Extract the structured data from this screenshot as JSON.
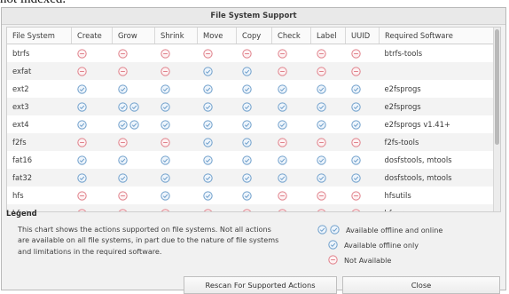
{
  "page_fragment": "not indexed.",
  "dialog": {
    "title": "File System Support"
  },
  "table": {
    "columns": [
      "File System",
      "Create",
      "Grow",
      "Shrink",
      "Move",
      "Copy",
      "Check",
      "Label",
      "UUID",
      "Required Software"
    ],
    "rows": [
      {
        "fs": "btrfs",
        "cells": [
          "na",
          "na",
          "na",
          "na",
          "na",
          "na",
          "na",
          "na"
        ],
        "software": "btrfs-tools"
      },
      {
        "fs": "exfat",
        "cells": [
          "na",
          "na",
          "na",
          "offline",
          "offline",
          "na",
          "na",
          "na"
        ],
        "software": ""
      },
      {
        "fs": "ext2",
        "cells": [
          "offline",
          "offline",
          "offline",
          "offline",
          "offline",
          "offline",
          "offline",
          "offline"
        ],
        "software": "e2fsprogs"
      },
      {
        "fs": "ext3",
        "cells": [
          "offline",
          "both",
          "offline",
          "offline",
          "offline",
          "offline",
          "offline",
          "offline"
        ],
        "software": "e2fsprogs"
      },
      {
        "fs": "ext4",
        "cells": [
          "offline",
          "both",
          "offline",
          "offline",
          "offline",
          "offline",
          "offline",
          "offline"
        ],
        "software": "e2fsprogs v1.41+"
      },
      {
        "fs": "f2fs",
        "cells": [
          "na",
          "na",
          "na",
          "offline",
          "offline",
          "na",
          "na",
          "na"
        ],
        "software": "f2fs-tools"
      },
      {
        "fs": "fat16",
        "cells": [
          "offline",
          "offline",
          "offline",
          "offline",
          "offline",
          "offline",
          "offline",
          "offline"
        ],
        "software": "dosfstools, mtools"
      },
      {
        "fs": "fat32",
        "cells": [
          "offline",
          "offline",
          "offline",
          "offline",
          "offline",
          "offline",
          "offline",
          "offline"
        ],
        "software": "dosfstools, mtools"
      },
      {
        "fs": "hfs",
        "cells": [
          "na",
          "na",
          "offline",
          "offline",
          "offline",
          "na",
          "na",
          "na"
        ],
        "software": "hfsutils"
      },
      {
        "fs": "hfs+",
        "cells": [
          "na",
          "na",
          "na",
          "na",
          "na",
          "na",
          "na",
          "na"
        ],
        "software": "hfsprogs"
      }
    ]
  },
  "legend": {
    "title": "Legend",
    "text": "This chart shows the actions supported on file systems. Not all actions are available on all file systems, in part due to the nature of file systems and limitations in the required software.",
    "items": [
      {
        "kind": "both",
        "label": "Available offline and online"
      },
      {
        "kind": "offline",
        "label": "Available offline only"
      },
      {
        "kind": "na",
        "label": "Not Available"
      }
    ]
  },
  "buttons": {
    "rescan": "Rescan For Supported Actions",
    "close": "Close"
  },
  "icons": {
    "check": "check-icon",
    "not_available": "no-entry-icon"
  },
  "colors": {
    "check": "#6f9fcb",
    "check_fill": "#eef5fc",
    "na": "#e0808a",
    "na_fill": "#fdf2f3"
  }
}
